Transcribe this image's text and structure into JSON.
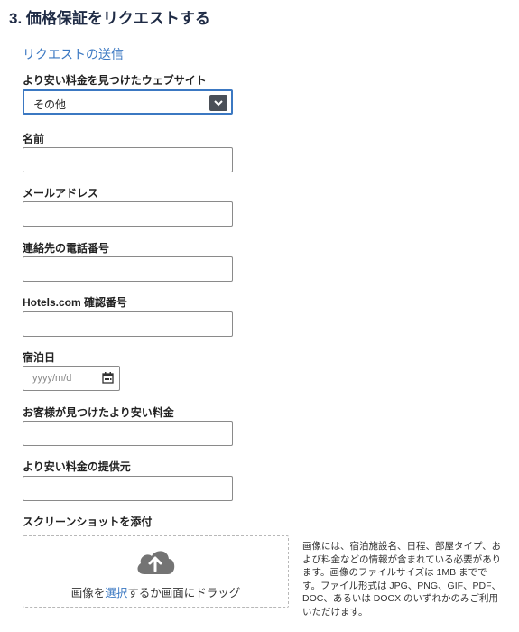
{
  "title": "3. 価格保証をリクエストする",
  "subtitle": "リクエストの送信",
  "fields": {
    "website": {
      "label": "より安い料金を見つけたウェブサイト",
      "value": "その他"
    },
    "name": {
      "label": "名前",
      "value": ""
    },
    "email": {
      "label": "メールアドレス",
      "value": ""
    },
    "phone": {
      "label": "連絡先の電話番号",
      "value": ""
    },
    "confirmation": {
      "label": "Hotels.com 確認番号",
      "value": ""
    },
    "stay_date": {
      "label": "宿泊日",
      "placeholder": "yyyy/m/d"
    },
    "lower_price": {
      "label": "お客様が見つけたより安い料金",
      "value": ""
    },
    "provider": {
      "label": "より安い料金の提供元",
      "value": ""
    }
  },
  "attachment": {
    "label": "スクリーンショットを添付",
    "text_before": "画像を",
    "link": "選択",
    "text_after": "するか画面にドラッグ",
    "icon": "cloud-upload-icon",
    "note": "画像には、宿泊施設名、日程、部屋タイプ、および料金などの情報が含まれている必要があります。画像のファイルサイズは 1MB までです。ファイル形式は JPG、PNG、GIF、PDF、DOC、あるいは DOCX のいずれかのみご利用いただけます。"
  },
  "colors": {
    "accent": "#3b78c2",
    "title": "#1f2b45",
    "select_arrow": "#4a4f57"
  }
}
